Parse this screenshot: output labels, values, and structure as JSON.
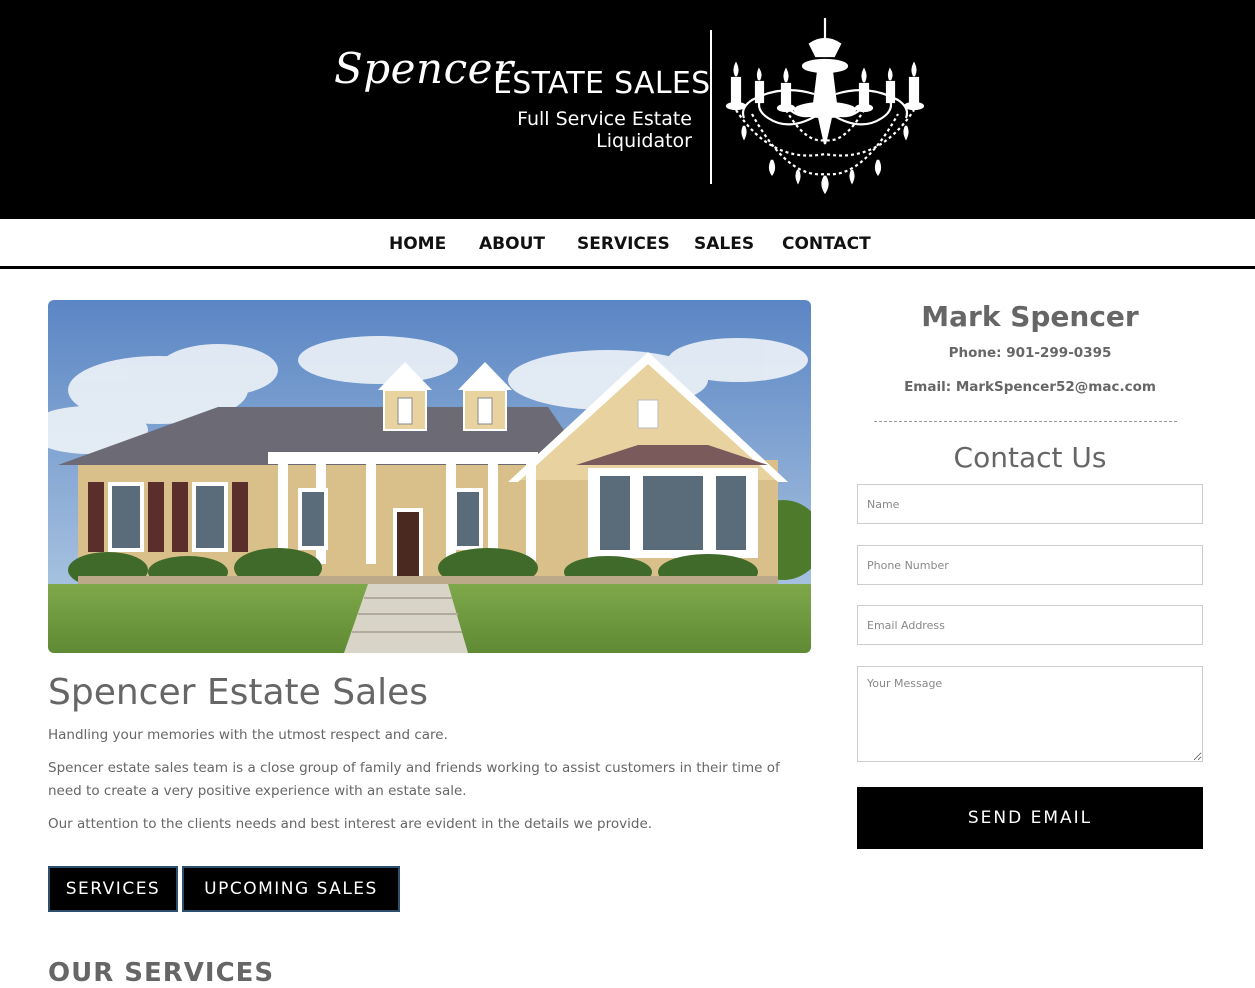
{
  "header": {
    "logo_script": "Spencer",
    "logo_caps": "ESTATE SALES",
    "tagline": "Full Service Estate Liquidator"
  },
  "nav": {
    "items": [
      "HOME",
      "ABOUT",
      "SERVICES",
      "SALES",
      "CONTACT"
    ]
  },
  "main": {
    "title": "Spencer Estate Sales",
    "intro": "Handling your memories with the utmost respect and care.",
    "body": "Spencer estate sales team is a close group of family and friends working to assist customers in their time of need to create a very positive experience with an estate sale.",
    "attention": "Our attention to the clients needs and best interest are evident in the details we provide.",
    "buttons": {
      "services": "SERVICES",
      "upcoming_sales": "UPCOMING SALES"
    },
    "next_section_title": "OUR SERVICES"
  },
  "sidebar": {
    "name": "Mark Spencer",
    "phone": "Phone: 901-299-0395",
    "email": "Email: MarkSpencer52@mac.com",
    "contact_title": "Contact Us",
    "form": {
      "name_placeholder": "Name",
      "phone_placeholder": "Phone Number",
      "email_placeholder": "Email Address",
      "message_placeholder": "Your Message",
      "submit_label": "SEND EMAIL"
    }
  },
  "colors": {
    "header_bg": "#000000",
    "text": "#666666",
    "button_bg": "#000000"
  }
}
